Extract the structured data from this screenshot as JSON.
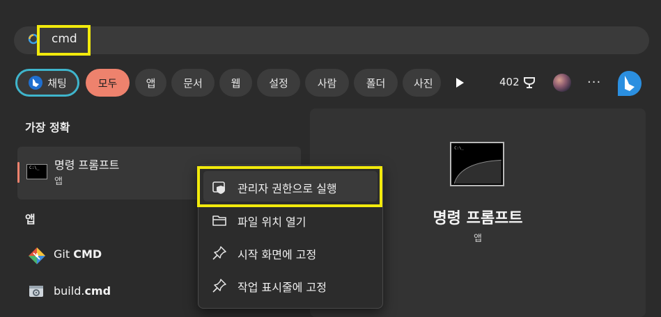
{
  "search": {
    "query": "cmd"
  },
  "filters": {
    "chips": [
      "채팅",
      "모두",
      "앱",
      "문서",
      "웹",
      "설정",
      "사람",
      "폴더",
      "사진"
    ],
    "points": "402",
    "more": "···"
  },
  "results": {
    "best_match_heading": "가장 정확",
    "best_match": {
      "title": "명령 프롬프트",
      "subtitle": "앱",
      "thumb_text": "C:\\_"
    },
    "apps_heading": "앱",
    "apps": [
      {
        "prefix": "Git ",
        "bold": "CMD",
        "icon": "git-icon"
      },
      {
        "prefix": "build.",
        "bold": "cmd",
        "icon": "build-file-icon"
      }
    ]
  },
  "preview": {
    "title": "명령 프롬프트",
    "subtitle": "앱"
  },
  "context_menu": {
    "items": [
      {
        "label": "관리자 권한으로 실행",
        "icon": "shield-icon"
      },
      {
        "label": "파일 위치 열기",
        "icon": "folder-icon"
      },
      {
        "label": "시작 화면에 고정",
        "icon": "pin-icon"
      },
      {
        "label": "작업 표시줄에 고정",
        "icon": "pin-icon"
      }
    ]
  },
  "colors": {
    "background": "#2b2b2b",
    "accent_chip": "#ee826d",
    "chat_border": "#3fb5cc",
    "highlight": "#f2ea0c"
  }
}
